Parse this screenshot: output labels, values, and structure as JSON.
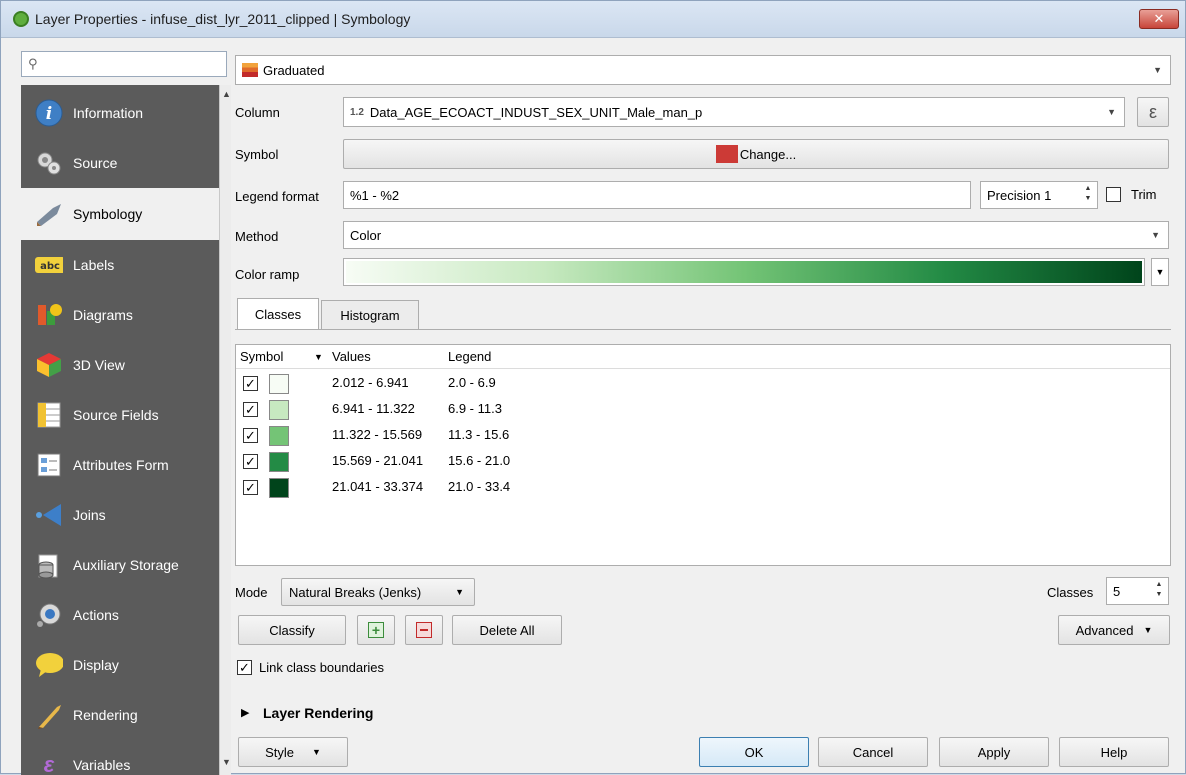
{
  "window": {
    "title": "Layer Properties - infuse_dist_lyr_2011_clipped | Symbology",
    "close_label": "✕"
  },
  "search": {
    "placeholder": "",
    "value": ""
  },
  "sidebar": {
    "items": [
      {
        "label": "Information",
        "icon": "info-icon"
      },
      {
        "label": "Source",
        "icon": "source-icon"
      },
      {
        "label": "Symbology",
        "icon": "symbology-icon"
      },
      {
        "label": "Labels",
        "icon": "labels-icon"
      },
      {
        "label": "Diagrams",
        "icon": "diagrams-icon"
      },
      {
        "label": "3D View",
        "icon": "cube-icon"
      },
      {
        "label": "Source Fields",
        "icon": "fields-icon"
      },
      {
        "label": "Attributes Form",
        "icon": "form-icon"
      },
      {
        "label": "Joins",
        "icon": "joins-icon"
      },
      {
        "label": "Auxiliary Storage",
        "icon": "database-icon"
      },
      {
        "label": "Actions",
        "icon": "actions-icon"
      },
      {
        "label": "Display",
        "icon": "display-icon"
      },
      {
        "label": "Rendering",
        "icon": "rendering-icon"
      },
      {
        "label": "Variables",
        "icon": "variables-icon"
      }
    ]
  },
  "renderer": {
    "value": "Graduated"
  },
  "column": {
    "label": "Column",
    "type_badge": "1.2",
    "value": "Data_AGE_ECOACT_INDUST_SEX_UNIT_Male_man_p",
    "expr_label": "ε"
  },
  "symbol": {
    "label": "Symbol",
    "button": "Change..."
  },
  "legend_format": {
    "label": "Legend format",
    "value": "%1 - %2",
    "precision": "Precision 1",
    "trim": "Trim"
  },
  "method": {
    "label": "Method",
    "value": "Color"
  },
  "color_ramp": {
    "label": "Color ramp",
    "colors": [
      "#f7fcf5",
      "#c7e9c0",
      "#74c476",
      "#238b45",
      "#00441b"
    ]
  },
  "tabs": [
    {
      "label": "Classes"
    },
    {
      "label": "Histogram"
    }
  ],
  "classes_table": {
    "headers": {
      "symbol": "Symbol",
      "values": "Values",
      "legend": "Legend"
    },
    "rows": [
      {
        "checked": "✓",
        "color": "#f7fcf5",
        "values": "2.012 - 6.941",
        "legend": "2.0 - 6.9"
      },
      {
        "checked": "✓",
        "color": "#c7e9c0",
        "values": "6.941 - 11.322",
        "legend": "6.9 - 11.3"
      },
      {
        "checked": "✓",
        "color": "#74c476",
        "values": "11.322 - 15.569",
        "legend": "11.3 - 15.6"
      },
      {
        "checked": "✓",
        "color": "#238b45",
        "values": "15.569 - 21.041",
        "legend": "15.6 - 21.0"
      },
      {
        "checked": "✓",
        "color": "#00441b",
        "values": "21.041 - 33.374",
        "legend": "21.0 - 33.4"
      }
    ]
  },
  "mode": {
    "label": "Mode",
    "value": "Natural Breaks (Jenks)"
  },
  "classes_count": {
    "label": "Classes",
    "value": "5"
  },
  "actions": {
    "classify": "Classify",
    "delete_all": "Delete All",
    "advanced": "Advanced"
  },
  "link_boundaries": {
    "checked": "✓",
    "label": "Link class boundaries"
  },
  "layer_rendering": {
    "label": "Layer Rendering"
  },
  "footer": {
    "style": "Style",
    "ok": "OK",
    "cancel": "Cancel",
    "apply": "Apply",
    "help": "Help"
  }
}
